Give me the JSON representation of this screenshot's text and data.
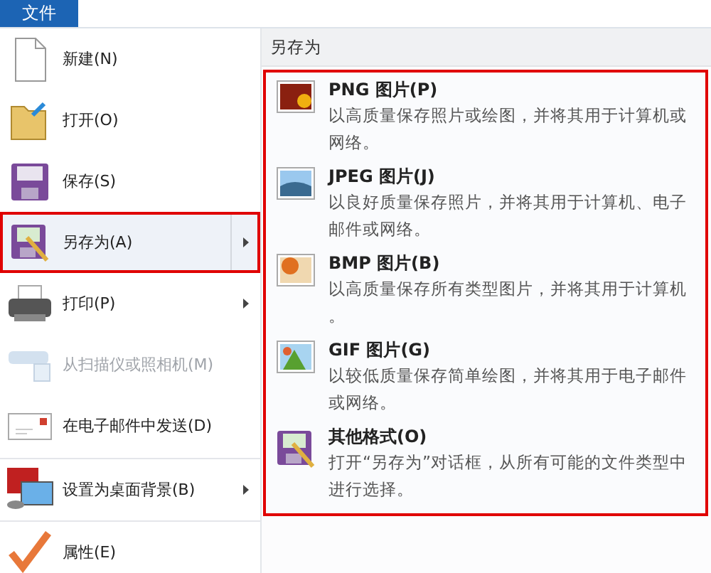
{
  "menu_tab": {
    "label": "文件"
  },
  "menu_items": [
    {
      "label": "新建(N)",
      "submenu": false,
      "selected": false,
      "disabled": false,
      "divider_before": false
    },
    {
      "label": "打开(O)",
      "submenu": false,
      "selected": false,
      "disabled": false,
      "divider_before": false
    },
    {
      "label": "保存(S)",
      "submenu": false,
      "selected": false,
      "disabled": false,
      "divider_before": false
    },
    {
      "label": "另存为(A)",
      "submenu": true,
      "selected": true,
      "disabled": false,
      "divider_before": false
    },
    {
      "label": "打印(P)",
      "submenu": true,
      "selected": false,
      "disabled": false,
      "divider_before": false
    },
    {
      "label": "从扫描仪或照相机(M)",
      "submenu": false,
      "selected": false,
      "disabled": true,
      "divider_before": false
    },
    {
      "label": "在电子邮件中发送(D)",
      "submenu": false,
      "selected": false,
      "disabled": false,
      "divider_before": false
    },
    {
      "label": "设置为桌面背景(B)",
      "submenu": true,
      "selected": false,
      "disabled": false,
      "divider_before": true
    },
    {
      "label": "属性(E)",
      "submenu": false,
      "selected": false,
      "disabled": false,
      "divider_before": true
    }
  ],
  "submenu": {
    "title": "另存为",
    "items": [
      {
        "title": "PNG 图片(P)",
        "description": "以高质量保存照片或绘图，并将其用于计算机或网络。"
      },
      {
        "title": "JPEG 图片(J)",
        "description": "以良好质量保存照片，并将其用于计算机、电子邮件或网络。"
      },
      {
        "title": "BMP 图片(B)",
        "description": "以高质量保存所有类型图片，并将其用于计算机。"
      },
      {
        "title": "GIF 图片(G)",
        "description": "以较低质量保存简单绘图，并将其用于电子邮件或网络。"
      },
      {
        "title": "其他格式(O)",
        "description": "打开“另存为”对话框，从所有可能的文件类型中进行选择。"
      }
    ]
  }
}
